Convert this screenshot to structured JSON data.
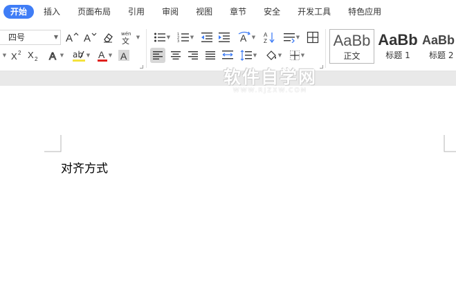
{
  "menu": {
    "tabs": [
      "开始",
      "插入",
      "页面布局",
      "引用",
      "审阅",
      "视图",
      "章节",
      "安全",
      "开发工具",
      "特色应用"
    ]
  },
  "font": {
    "size_value": "四号",
    "grow_glyph": "A⁺",
    "shrink_glyph": "A⁻",
    "phonetic_glyph": "wén",
    "superscript_glyph": "X²",
    "subscript_glyph": "X₂",
    "effect_glyph": "A",
    "highlight_glyph": "ab",
    "color_glyph": "A",
    "shade_glyph": "A"
  },
  "styles": [
    {
      "sample": "AaBb",
      "label": "正文"
    },
    {
      "sample": "AaBb",
      "label": "标题 1"
    },
    {
      "sample": "AaBb",
      "label": "标题 2"
    }
  ],
  "watermark": {
    "title": "软件自学网",
    "url": "WWW.RJZXW.COM"
  },
  "document": {
    "text": "对齐方式"
  },
  "colors": {
    "accent": "#3f7df6",
    "font_color_bar": "#e0201c",
    "highlight_bar": "#f4e23c",
    "canvas": "#e9e9e9"
  }
}
